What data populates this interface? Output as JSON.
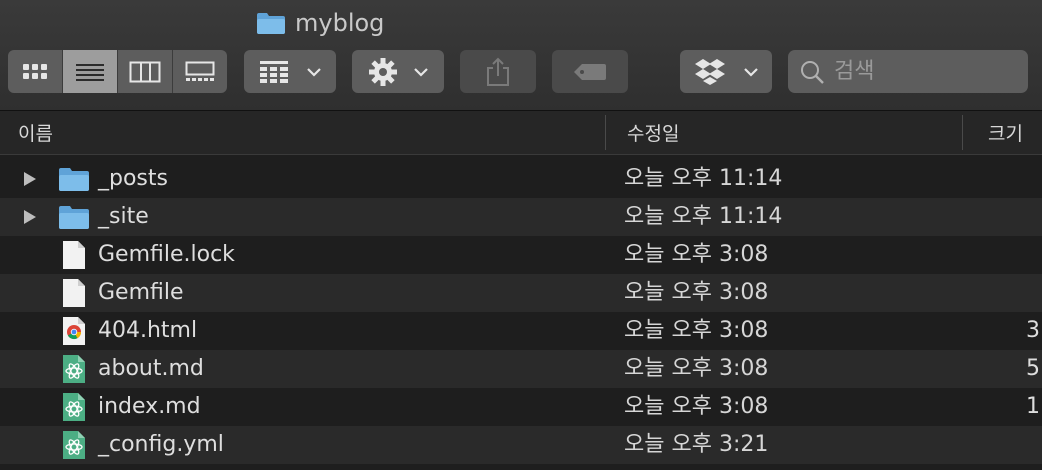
{
  "window": {
    "title": "myblog"
  },
  "toolbar": {
    "view_modes": [
      "icon-view",
      "list-view",
      "column-view",
      "gallery-view"
    ],
    "active_view": "list-view",
    "search_placeholder": "검색"
  },
  "columns": {
    "name": "이름",
    "modified": "수정일",
    "size": "크기"
  },
  "files": [
    {
      "name": "_posts",
      "modified": "오늘 오후 11:14",
      "size": "",
      "kind": "folder"
    },
    {
      "name": "_site",
      "modified": "오늘 오후 11:14",
      "size": "",
      "kind": "folder"
    },
    {
      "name": "Gemfile.lock",
      "modified": "오늘 오후 3:08",
      "size": "",
      "kind": "document"
    },
    {
      "name": "Gemfile",
      "modified": "오늘 오후 3:08",
      "size": "",
      "kind": "document"
    },
    {
      "name": "404.html",
      "modified": "오늘 오후 3:08",
      "size": "3",
      "kind": "html"
    },
    {
      "name": "about.md",
      "modified": "오늘 오후 3:08",
      "size": "5",
      "kind": "markdown"
    },
    {
      "name": "index.md",
      "modified": "오늘 오후 3:08",
      "size": "1",
      "kind": "markdown"
    },
    {
      "name": "_config.yml",
      "modified": "오늘 오후 3:21",
      "size": "",
      "kind": "markdown"
    }
  ],
  "colors": {
    "folder": "#6aaee0",
    "accent": "#9d9d9d",
    "markdown": "#4cae84"
  }
}
